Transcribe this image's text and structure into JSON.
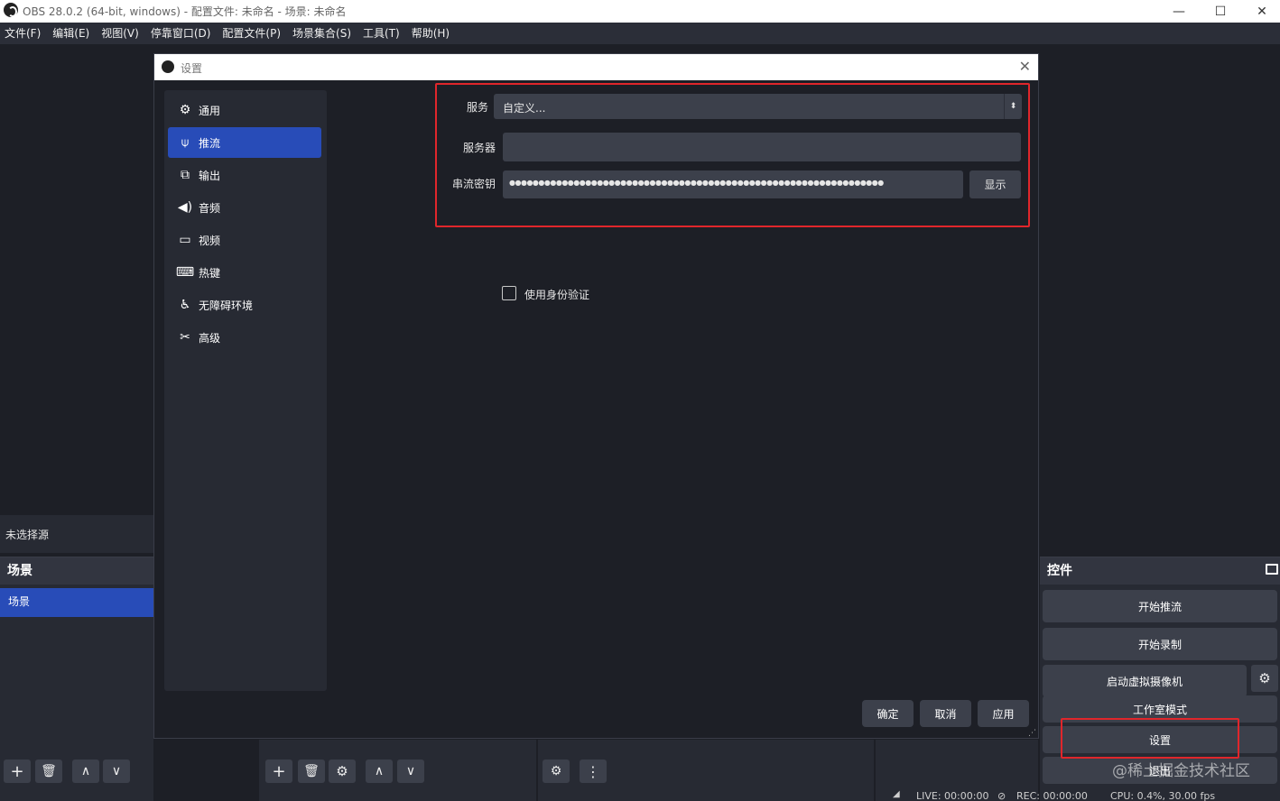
{
  "window": {
    "title": "OBS 28.0.2 (64-bit, windows) - 配置文件: 未命名 - 场景: 未命名",
    "min": "—",
    "max": "☐",
    "close": "✕"
  },
  "menu": [
    "文件(F)",
    "编辑(E)",
    "视图(V)",
    "停靠窗口(D)",
    "配置文件(P)",
    "场景集合(S)",
    "工具(T)",
    "帮助(H)"
  ],
  "source_bar": {
    "text": "未选择源"
  },
  "scenes": {
    "header": "场景",
    "items": [
      "场景"
    ]
  },
  "controls": {
    "header": "控件",
    "buttons": [
      "开始推流",
      "开始录制",
      "启动虚拟摄像机",
      "工作室模式",
      "设置",
      "退出"
    ]
  },
  "dialog": {
    "title": "设置",
    "sidebar": [
      {
        "label": "通用",
        "icon": "gear-icon"
      },
      {
        "label": "推流",
        "icon": "broadcast-icon"
      },
      {
        "label": "输出",
        "icon": "output-icon"
      },
      {
        "label": "音频",
        "icon": "speaker-icon"
      },
      {
        "label": "视频",
        "icon": "monitor-icon"
      },
      {
        "label": "热键",
        "icon": "keyboard-icon"
      },
      {
        "label": "无障碍环境",
        "icon": "accessibility-icon"
      },
      {
        "label": "高级",
        "icon": "tools-icon"
      }
    ],
    "form": {
      "service_label": "服务",
      "service_value": "自定义...",
      "server_label": "服务器",
      "server_value": "",
      "key_label": "串流密钥",
      "key_value": "●●●●●●●●●●●●●●●●●●●●●●●●●●●●●●●●●●●●●●●●●●●●●●●●●●●●●●●●●●●●●●●●",
      "show_button": "显示",
      "auth_checkbox": "使用身份验证"
    },
    "buttons": {
      "ok": "确定",
      "cancel": "取消",
      "apply": "应用"
    }
  },
  "status": {
    "live": "LIVE: 00:00:00",
    "rec": "REC: 00:00:00",
    "cpu": "CPU: 0.4%, 30.00 fps"
  },
  "watermark": "@稀土掘金技术社区",
  "colors": {
    "accent": "#284cb8",
    "highlight": "#e0262b",
    "panel": "#272a33",
    "button": "#3c404b"
  }
}
